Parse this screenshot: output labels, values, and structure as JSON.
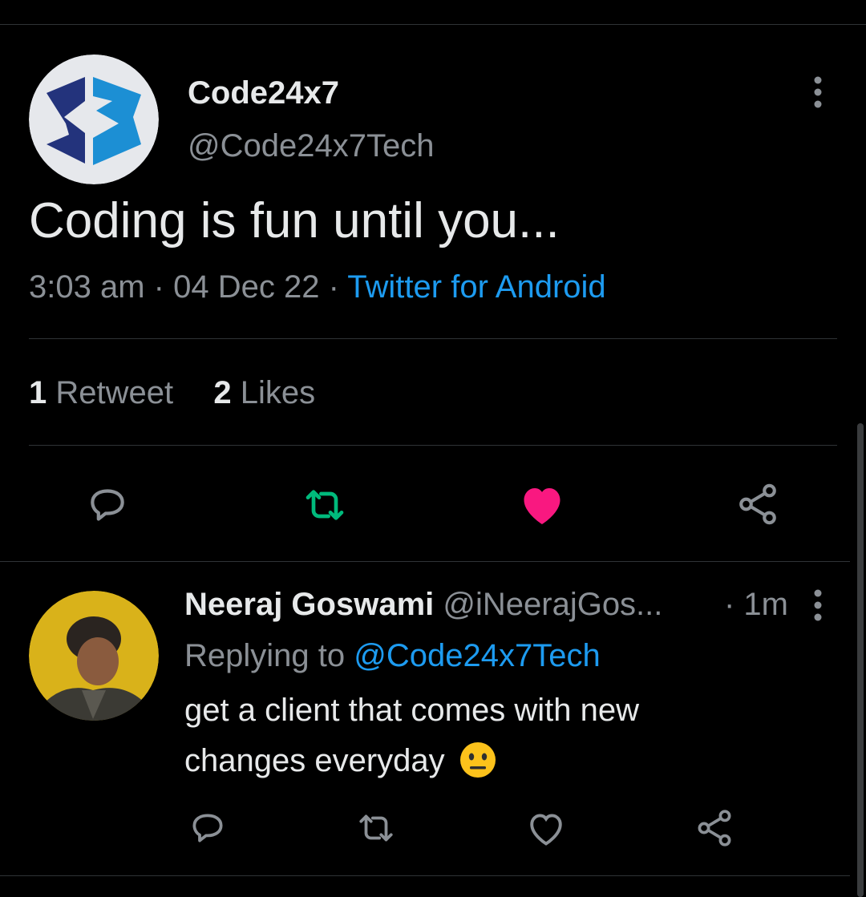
{
  "tweet": {
    "author_name": "Code24x7",
    "author_handle": "@Code24x7Tech",
    "text": "Coding is fun until you...",
    "time": "3:03 am",
    "date": "04 Dec 22",
    "source": "Twitter for Android",
    "sep": "·",
    "retweet_count": "1",
    "retweet_label": "Retweet",
    "like_count": "2",
    "like_label": "Likes",
    "liked": true,
    "colors": {
      "retweet": "#00ba7c",
      "like": "#f91880",
      "link": "#1d9bf0"
    }
  },
  "reply": {
    "author_name": "Neeraj Goswami",
    "author_handle": "@iNeerajGos...",
    "time": "· 1m",
    "replying_prefix": "Replying to",
    "replying_to": "@Code24x7Tech",
    "text_line1": "get a client that comes with new",
    "text_line2": "changes everyday",
    "emoji": "neutral-face-emoji"
  },
  "icons": [
    "more-icon",
    "reply-icon",
    "retweet-icon",
    "like-icon",
    "share-icon"
  ]
}
